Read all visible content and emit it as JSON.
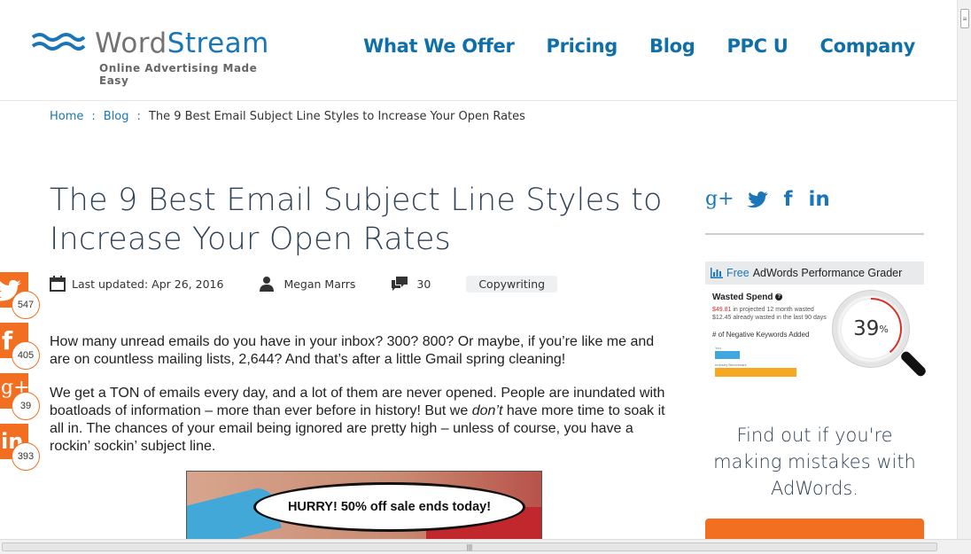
{
  "brand": {
    "name_part1": "Word",
    "name_part2": "Stream",
    "tagline": "Online Advertising Made Easy",
    "colors": {
      "primary": "#1a76b8",
      "accent": "#f26f21",
      "heading": "#2f4256"
    }
  },
  "nav": {
    "items": [
      {
        "label": "What We Offer"
      },
      {
        "label": "Pricing"
      },
      {
        "label": "Blog"
      },
      {
        "label": "PPC U"
      },
      {
        "label": "Company"
      }
    ]
  },
  "breadcrumb": {
    "home": "Home",
    "blog": "Blog",
    "separator": ":",
    "current": "The 9 Best Email Subject Line Styles to Increase Your Open Rates"
  },
  "article": {
    "title": "The 9 Best Email Subject Line Styles to Increase Your Open Rates",
    "updated": "Last updated: Apr 26, 2016",
    "author": "Megan Marrs",
    "comments": "30",
    "category": "Copywriting",
    "paragraphs": [
      "How many unread emails do you have in your inbox? 300? 800? Or maybe, if you’re like me and are on countless mailing lists, 2,644? And that’s after a little Gmail spring cleaning!"
    ],
    "p2_before": "We get a TON of emails every day, and a lot of them are never opened. People are inundated with boatloads of information – more than ever before in history! But we ",
    "p2_em": "don’t",
    "p2_after": " have more time to soak it all in. The chances of your email being ignored are pretty high – unless of course, you have a rockin’ sockin’ subject line.",
    "image_caption_text": "HURRY! 50% off sale ends today!"
  },
  "share": {
    "items": [
      {
        "network": "twitter",
        "icon": "twitter-icon",
        "glyph": "🐦",
        "count": "547"
      },
      {
        "network": "facebook",
        "icon": "facebook-icon",
        "glyph": "f",
        "count": "405"
      },
      {
        "network": "google-plus",
        "icon": "google-plus-icon",
        "glyph": "g+",
        "count": "39"
      },
      {
        "network": "linkedin",
        "icon": "linkedin-icon",
        "glyph": "in",
        "count": "393"
      }
    ]
  },
  "sidebar": {
    "social": [
      {
        "network": "google-plus",
        "glyph": "g+"
      },
      {
        "network": "twitter",
        "glyph": "🐦"
      },
      {
        "network": "facebook",
        "glyph": "f"
      },
      {
        "network": "linkedin",
        "glyph": "in"
      }
    ],
    "ad": {
      "free": "Free",
      "title": "AdWords Performance Grader",
      "wasted_label": "Wasted Spend",
      "wasted_line1_amount": "$49.81",
      "wasted_line1_text": " in projected 12 month wasted",
      "wasted_line2": "$12.45 already wasted in the last 90 days",
      "neg_kw_label": "# of Negative Keywords Added",
      "bar1_label": "You",
      "bar2_label": "Industry Benchmark",
      "score": "39",
      "score_unit": "%"
    },
    "cta_text": "Find out if you're making mistakes with AdWords."
  }
}
